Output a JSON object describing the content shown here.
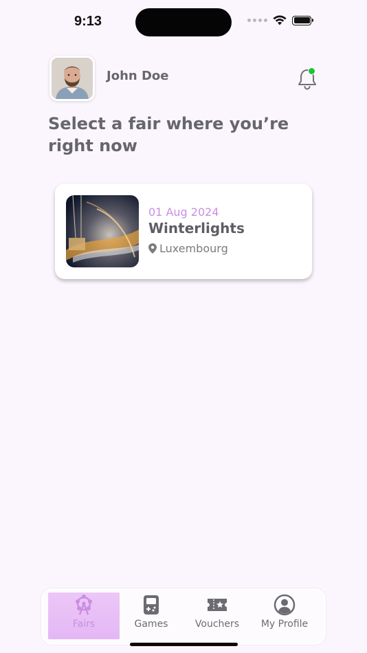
{
  "status_bar": {
    "time": "9:13"
  },
  "user": {
    "name": "John Doe"
  },
  "page": {
    "title": "Select a fair where you’re right now"
  },
  "fairs": [
    {
      "date": "01 Aug 2024",
      "name": "Winterlights",
      "location": "Luxembourg"
    }
  ],
  "nav": {
    "items": [
      {
        "label": "Fairs",
        "icon": "ferris-wheel-icon",
        "active": true
      },
      {
        "label": "Games",
        "icon": "game-console-icon",
        "active": false
      },
      {
        "label": "Vouchers",
        "icon": "ticket-icon",
        "active": false
      },
      {
        "label": "My Profile",
        "icon": "profile-icon",
        "active": false
      }
    ]
  },
  "colors": {
    "accent": "#c98ee6",
    "active_tab_bg": "#e8bff6",
    "notification_dot": "#1ec532",
    "background": "#fbf6fd"
  }
}
